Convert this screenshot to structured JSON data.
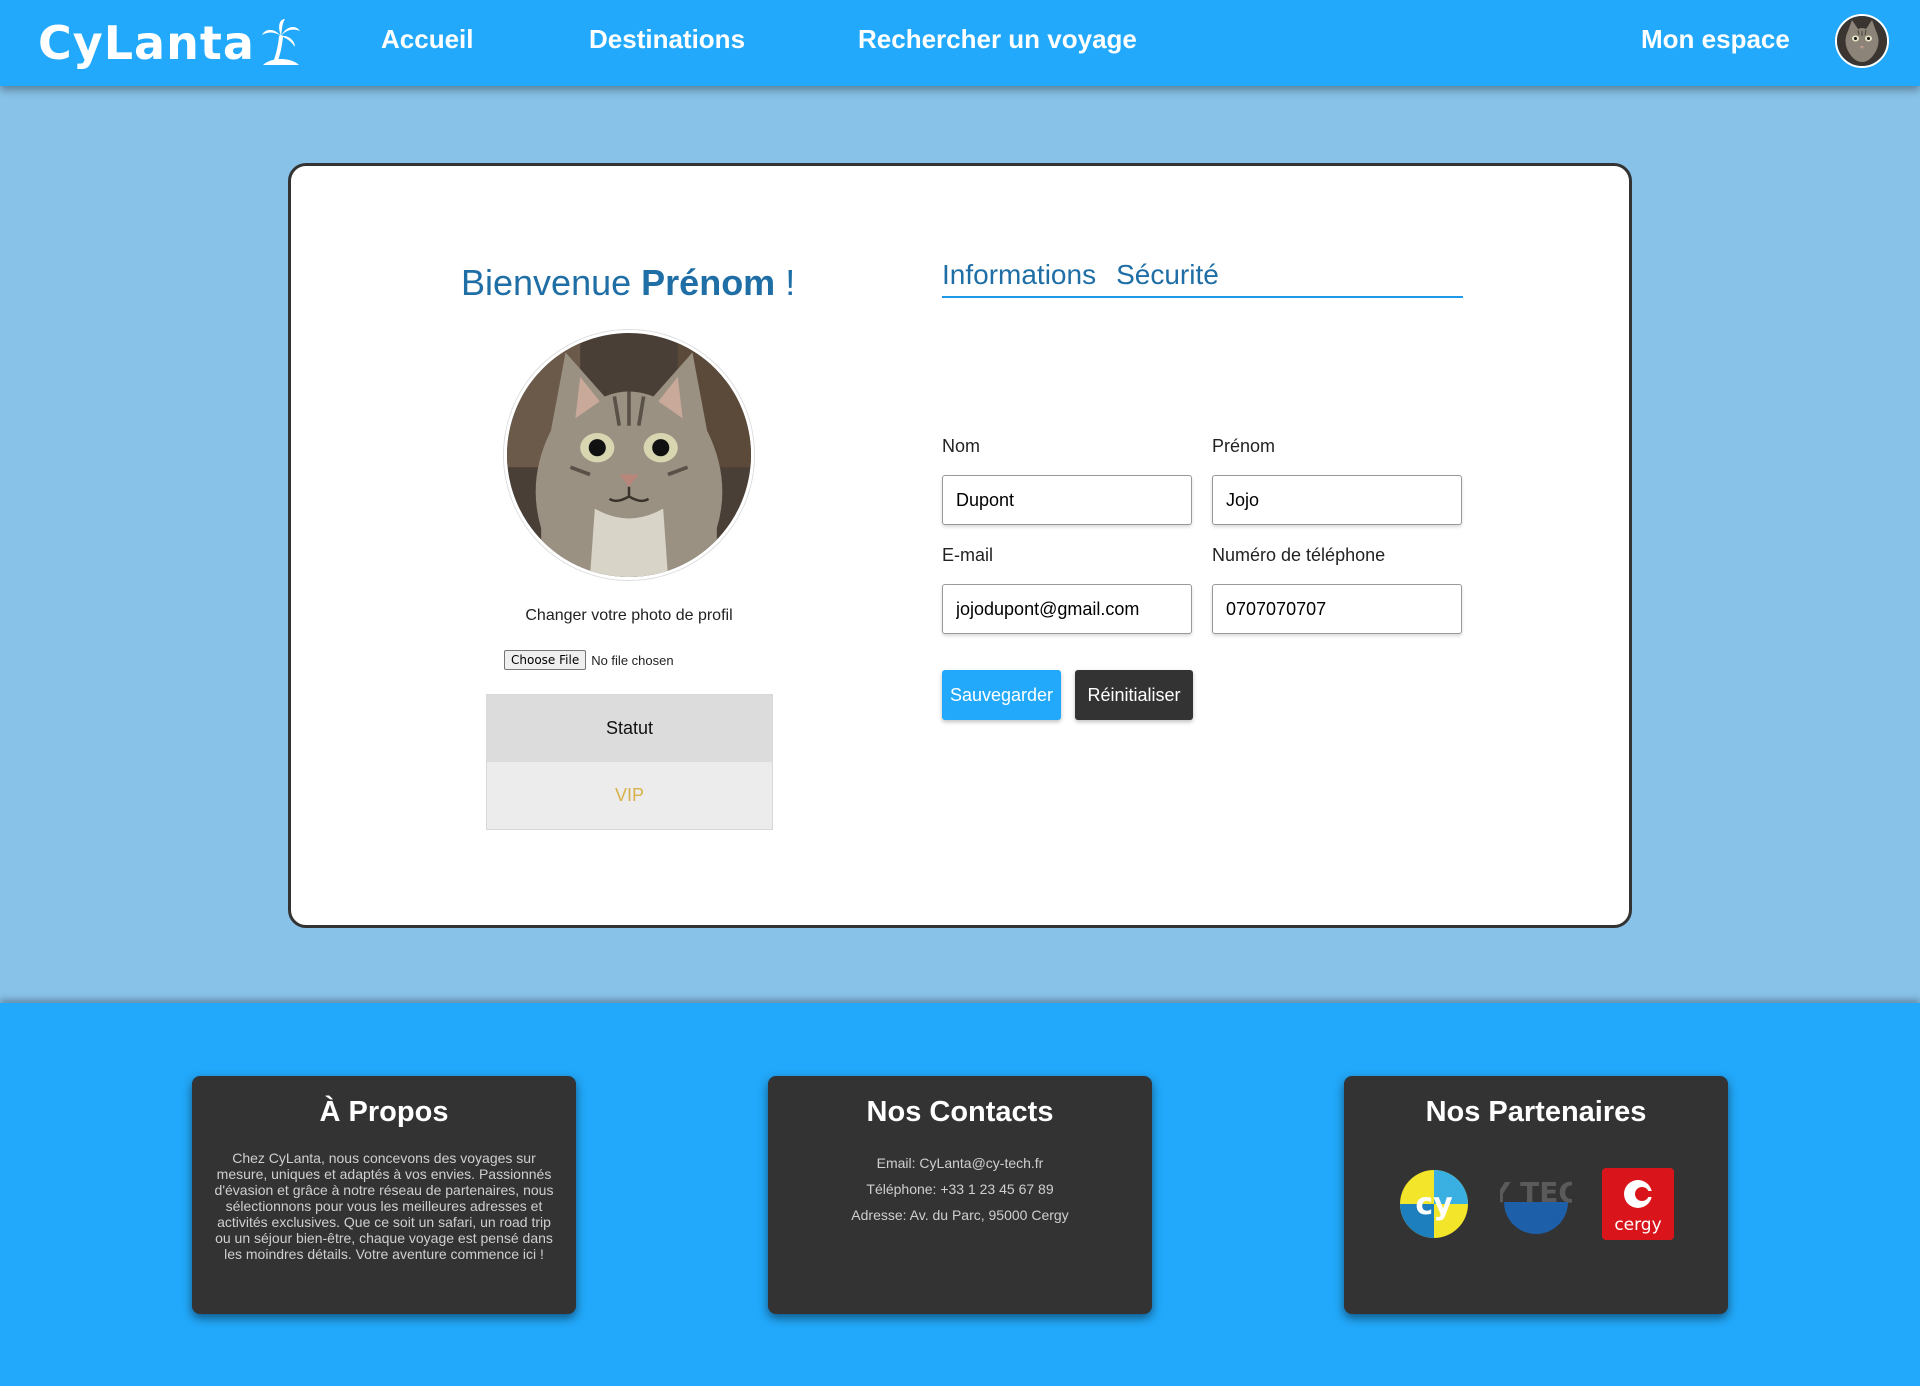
{
  "header": {
    "logo": "CyLanta",
    "nav": [
      "Accueil",
      "Destinations",
      "Rechercher un voyage"
    ],
    "account": "Mon espace"
  },
  "profile": {
    "welcome_prefix": "Bienvenue",
    "welcome_name": "Prénom",
    "welcome_suffix": "!",
    "change_photo": "Changer votre photo de profil",
    "file_button": "Choose File",
    "file_status": "No file chosen",
    "status_header": "Statut",
    "status_value": "VIP"
  },
  "tabs": [
    "Informations",
    "Sécurité"
  ],
  "form": {
    "nom_label": "Nom",
    "nom_value": "Dupont",
    "prenom_label": "Prénom",
    "prenom_value": "Jojo",
    "email_label": "E-mail",
    "email_value": "jojodupont@gmail.com",
    "phone_label": "Numéro de téléphone",
    "phone_value": "0707070707",
    "save_label": "Sauvegarder",
    "reset_label": "Réinitialiser"
  },
  "footer": {
    "about_title": "À Propos",
    "about_text": "Chez CyLanta, nous concevons des voyages sur mesure, uniques et adaptés à vos envies. Passionnés d'évasion et grâce à notre réseau de partenaires, nous sélectionnons pour vous les meilleures adresses et activités exclusives. Que ce soit un safari, un road trip ou un séjour bien-être, chaque voyage est pensé dans les moindres détails. Votre aventure commence ici !",
    "contacts_title": "Nos Contacts",
    "contact_email": "Email: CyLanta@cy-tech.fr",
    "contact_phone": "Téléphone: +33 1 23 45 67 89",
    "contact_address": "Adresse: Av. du Parc, 95000 Cergy",
    "partners_title": "Nos Partenaires",
    "partners": [
      {
        "icon": "cy-logo",
        "text": "cy"
      },
      {
        "icon": "cy-tech-logo",
        "text": "CY TECH"
      },
      {
        "icon": "cergy-logo",
        "text": "cergy"
      }
    ]
  },
  "colors": {
    "primary": "#22a9fb",
    "page_bg": "#88c2e8",
    "dark": "#333333",
    "title_blue": "#1f6ea5",
    "vip_gold": "#d8b14a"
  }
}
